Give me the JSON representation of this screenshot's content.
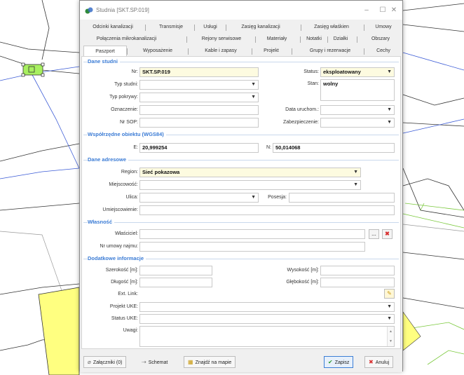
{
  "window": {
    "title": "Studnia [SKT.SP.019]",
    "minimize": "–",
    "maximize": "☐",
    "close": "✕"
  },
  "tabs_row1": [
    "Odcinki kanalizacji",
    "Transmisje",
    "Usługi",
    "Zasięg kanalizacji",
    "Zasięg właśkien",
    "Umowy"
  ],
  "tabs_row2": [
    "Połączenia mikrokanalizacji",
    "Rejony serwisowe",
    "Materiały",
    "Notatki",
    "Działki",
    "Obszary"
  ],
  "tabs_row3": [
    "Paszport",
    "Wyposażenie",
    "Kable i zapasy",
    "Projekt",
    "Grupy i rezerwacje",
    "Cechy"
  ],
  "sections": {
    "dane_studni": "Dane studni",
    "wspolrzedne": "Współrzędne obiektu (WGS84)",
    "dane_adresowe": "Dane adresowe",
    "wlasnosc": "Własność",
    "dodatkowe": "Dodatkowe informacje"
  },
  "fields": {
    "nr_label": "Nr:",
    "nr_value": "SKT.SP.019",
    "typ_studni_label": "Typ studni:",
    "typ_pokrywy_label": "Typ pokrywy:",
    "oznaczenie_label": "Oznaczenie:",
    "nr_sop_label": "Nr SOP:",
    "status_label": "Status:",
    "status_value": "eksploatowany",
    "stan_label": "Stan:",
    "stan_value": "wolny",
    "data_uruchom_label": "Data uruchom.:",
    "zabezpieczenie_label": "Zabezpieczenie:",
    "e_label": "E:",
    "e_value": "20,999254",
    "n_label": "N:",
    "n_value": "50,014068",
    "region_label": "Region:",
    "region_value": "Sieć pokazowa",
    "miejscowosc_label": "Miejscowość:",
    "ulica_label": "Ulica:",
    "posesja_label": "Posesja:",
    "umiejscowienie_label": "Umiejscowienie:",
    "wlasciciel_label": "Właściciel:",
    "nr_umowy_label": "Nr umowy najmu:",
    "szerokosc_label": "Szerokość [m]:",
    "dlugosc_label": "Długość [m]:",
    "wysokosc_label": "Wysokość [m]:",
    "glebokosc_label": "Głębokość [m]:",
    "ext_link_label": "Ext. Link:",
    "projekt_uke_label": "Projekt UKE:",
    "status_uke_label": "Status UKE:",
    "uwagi_label": "Uwagi:",
    "ellipsis": "..."
  },
  "bottom": {
    "zalaczniki": "Załączniki (0)",
    "schemat": "Schemat",
    "znajdz": "Znajdź na mapie",
    "zapisz": "Zapisz",
    "anuluj": "Anuluj"
  },
  "colors": {
    "accent": "#3a7bd5",
    "required_bg": "#fdfbe0",
    "map_yellow": "#ffff80",
    "map_green": "#a8f060"
  }
}
